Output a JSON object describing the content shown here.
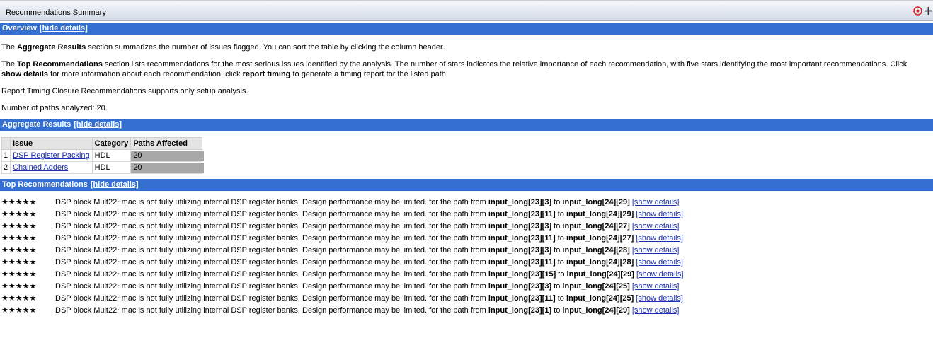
{
  "window": {
    "title": "Recommendations Summary"
  },
  "overview": {
    "heading": "Overview",
    "toggle_label": "[hide details]",
    "p1_pre": "The ",
    "p1_bold": "Aggregate Results",
    "p1_post": " section summarizes the number of issues flagged. You can sort the table by clicking the column header.",
    "p2_a": "The ",
    "p2_b": "Top Recommendations",
    "p2_c": " section lists recommendations for the most serious issues identified by the analysis. The number of stars indicates the relative importance of each recommendation, with five stars identifying the most important recommendations. Click ",
    "p2_d": "show details",
    "p2_e": " for more information about each recommendation; click ",
    "p2_f": "report timing",
    "p2_g": " to generate a timing report for the listed path.",
    "p3": "Report Timing Closure Recommendations supports only setup analysis.",
    "p4": "Number of paths analyzed: 20."
  },
  "aggregate": {
    "heading": "Aggregate Results",
    "toggle_label": "[hide details]",
    "columns": [
      "Issue",
      "Category",
      "Paths Affected"
    ],
    "rows": [
      {
        "index": "1",
        "issue": "DSP Register Packing",
        "category": "HDL",
        "paths": "20",
        "fraction": 1.0
      },
      {
        "index": "2",
        "issue": "Chained Adders",
        "category": "HDL",
        "paths": "20",
        "fraction": 1.0
      }
    ]
  },
  "recommendations": {
    "heading": "Top Recommendations",
    "toggle_label": "[hide details]",
    "stars": "★★★★★",
    "message": "DSP block Mult22~mac is not fully utilizing internal DSP register banks. Design performance may be limited. for the path from ",
    "to_word": " to ",
    "details_label": "[show details]",
    "items": [
      {
        "from": "input_long[23][3]",
        "to": "input_long[24][29]"
      },
      {
        "from": "input_long[23][11]",
        "to": "input_long[24][29]"
      },
      {
        "from": "input_long[23][3]",
        "to": "input_long[24][27]"
      },
      {
        "from": "input_long[23][11]",
        "to": "input_long[24][27]"
      },
      {
        "from": "input_long[23][3]",
        "to": "input_long[24][28]"
      },
      {
        "from": "input_long[23][11]",
        "to": "input_long[24][28]"
      },
      {
        "from": "input_long[23][15]",
        "to": "input_long[24][29]"
      },
      {
        "from": "input_long[23][3]",
        "to": "input_long[24][25]"
      },
      {
        "from": "input_long[23][11]",
        "to": "input_long[24][25]"
      },
      {
        "from": "input_long[23][1]",
        "to": "input_long[24][29]"
      }
    ]
  },
  "colors": {
    "section_bar": "#336ed1",
    "link": "#1a2fb0",
    "paths_bar": "#a8a8a8"
  }
}
